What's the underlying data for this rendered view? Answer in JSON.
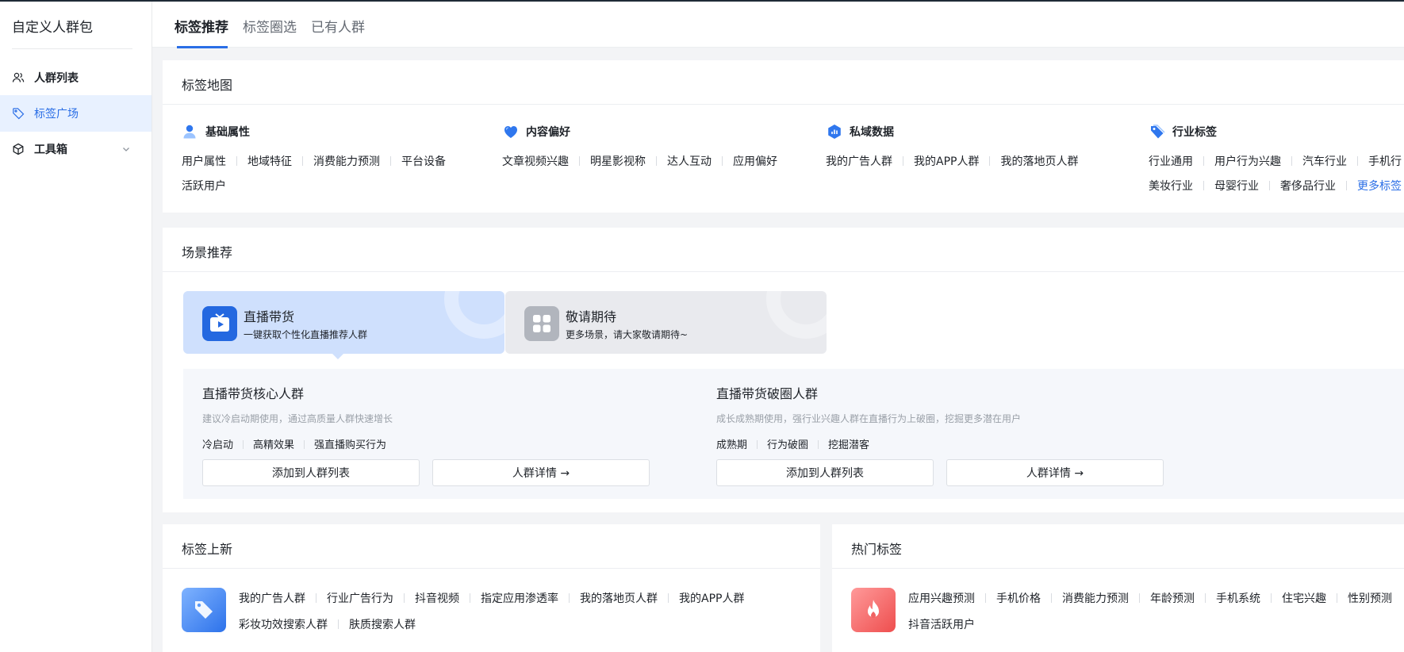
{
  "sidebar": {
    "title": "自定义人群包",
    "items": [
      {
        "label": "人群列表",
        "icon": "users-icon"
      },
      {
        "label": "标签广场",
        "icon": "tag-icon"
      },
      {
        "label": "工具箱",
        "icon": "box-icon"
      }
    ]
  },
  "tabs": [
    "标签推荐",
    "标签圈选",
    "已有人群"
  ],
  "tag_map": {
    "title": "标签地图",
    "groups": [
      {
        "name": "基础属性",
        "icon": "person-icon",
        "rows": [
          [
            "用户属性",
            "地域特征",
            "消费能力预测",
            "平台设备"
          ],
          [
            "活跃用户"
          ]
        ]
      },
      {
        "name": "内容偏好",
        "icon": "heart-icon",
        "rows": [
          [
            "文章视频兴趣",
            "明星影视称",
            "达人互动",
            "应用偏好"
          ]
        ]
      },
      {
        "name": "私域数据",
        "icon": "chart-box-icon",
        "rows": [
          [
            "我的广告人群",
            "我的APP人群",
            "我的落地页人群"
          ]
        ]
      },
      {
        "name": "行业标签",
        "icon": "tag-filled-icon",
        "rows": [
          [
            "行业通用",
            "用户行为兴趣",
            "汽车行业",
            "手机行"
          ],
          [
            "美妆行业",
            "母婴行业",
            "奢侈品行业"
          ]
        ],
        "more": "更多标签"
      }
    ]
  },
  "scenario": {
    "title": "场景推荐",
    "cards": [
      {
        "title": "直播带货",
        "sub": "一键获取个性化直播推荐人群",
        "icon": "tv-play-icon"
      },
      {
        "title": "敬请期待",
        "sub": "更多场景，请大家敬请期待~",
        "icon": "grid-icon"
      }
    ],
    "audiences": [
      {
        "title": "直播带货核心人群",
        "desc": "建议冷启动期使用，通过高质量人群快速增长",
        "tags": [
          "冷启动",
          "高精效果",
          "强直播购买行为"
        ]
      },
      {
        "title": "直播带货破圈人群",
        "desc": "成长成熟期使用，强行业兴趣人群在直播行为上破圈，挖掘更多潜在用户",
        "tags": [
          "成熟期",
          "行为破圈",
          "挖掘潜客"
        ]
      }
    ],
    "add_label": "添加到人群列表",
    "detail_label": "人群详情 →"
  },
  "new_tags": {
    "title": "标签上新",
    "rows": [
      [
        "我的广告人群",
        "行业广告行为",
        "抖音视频",
        "指定应用渗透率",
        "我的落地页人群",
        "我的APP人群"
      ],
      [
        "彩妆功效搜索人群",
        "肤质搜索人群"
      ]
    ]
  },
  "hot_tags": {
    "title": "热门标签",
    "rows": [
      [
        "应用兴趣预测",
        "手机价格",
        "消费能力预测",
        "年龄预测",
        "手机系统",
        "住宅兴趣",
        "性别预测"
      ],
      [
        "抖音活跃用户"
      ]
    ]
  }
}
